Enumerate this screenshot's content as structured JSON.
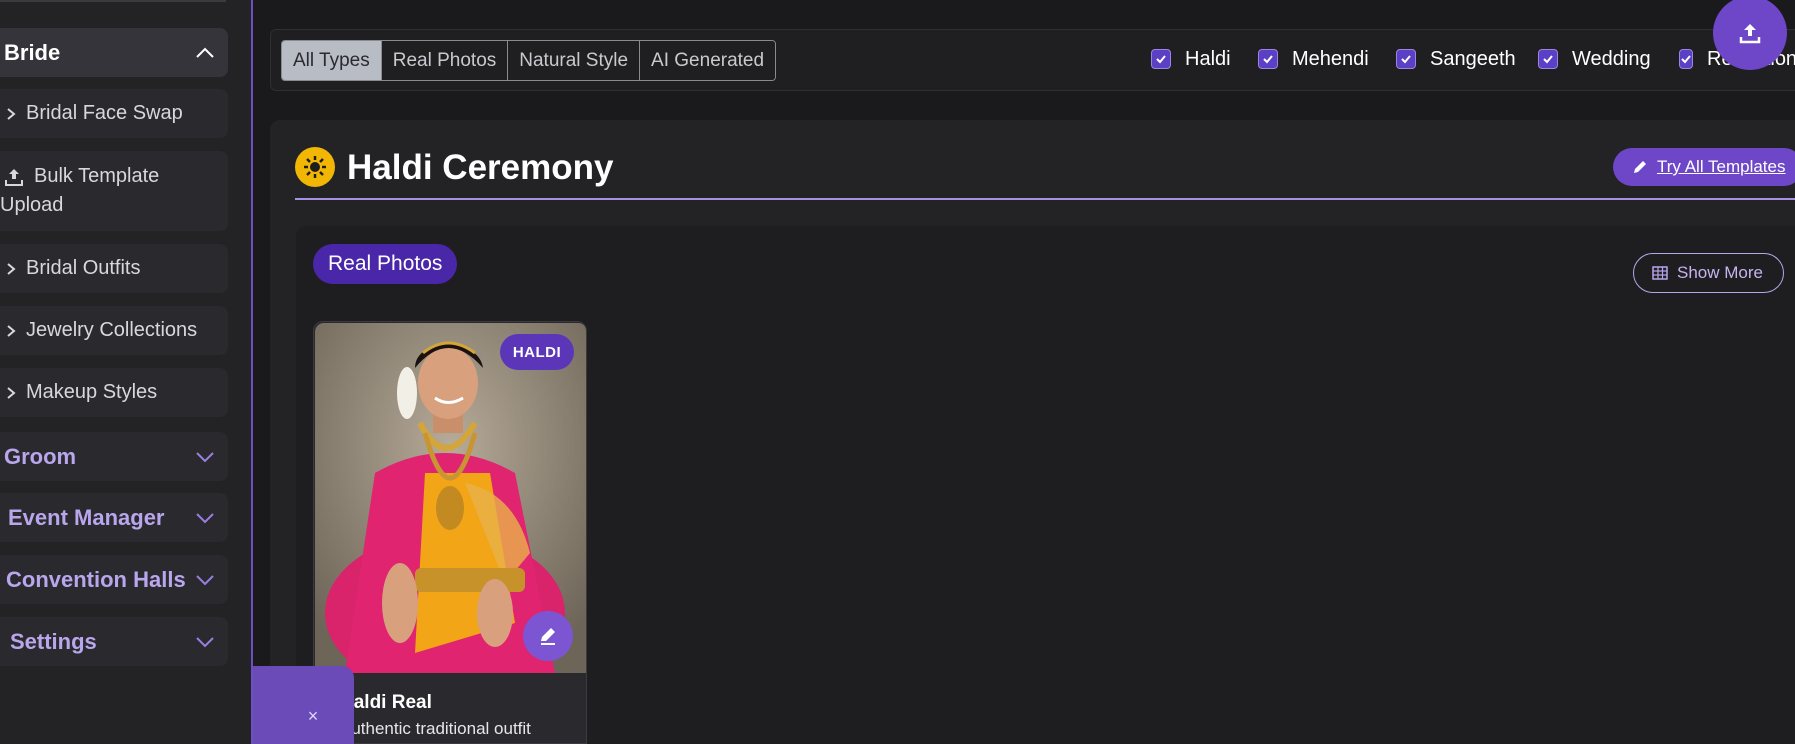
{
  "sidebar": {
    "sections": [
      {
        "label": "Bride",
        "expanded": true
      },
      {
        "label": "Groom",
        "expanded": false
      },
      {
        "label": "Event Manager",
        "expanded": false
      },
      {
        "label": "Convention Halls",
        "expanded": false
      },
      {
        "label": "Settings",
        "expanded": false
      }
    ],
    "bride_items": [
      {
        "label": "Bridal Face Swap",
        "icon": "chevron-right-icon"
      },
      {
        "label": "Bulk Template",
        "label2": "Upload",
        "icon": "upload-icon"
      },
      {
        "label": "Bridal Outfits",
        "icon": "chevron-right-icon"
      },
      {
        "label": "Jewelry Collections",
        "icon": "chevron-right-icon"
      },
      {
        "label": "Makeup Styles",
        "icon": "chevron-right-icon"
      }
    ]
  },
  "filters": {
    "types": [
      "All Types",
      "Real Photos",
      "Natural Style",
      "AI Generated"
    ],
    "active_type": "All Types",
    "events": [
      {
        "label": "Haldi",
        "checked": true
      },
      {
        "label": "Mehendi",
        "checked": true
      },
      {
        "label": "Sangeeth",
        "checked": true
      },
      {
        "label": "Wedding",
        "checked": true
      },
      {
        "label": "Reception",
        "checked": true
      }
    ]
  },
  "section": {
    "title": "Haldi Ceremony",
    "icon": "sun-icon",
    "try_all": "Try All Templates"
  },
  "group": {
    "label": "Real Photos",
    "show_more": "Show More"
  },
  "card": {
    "badge": "HALDI",
    "title": "Haldi Real",
    "description": "Authentic traditional outfit"
  },
  "toast": {
    "close": "×"
  },
  "colors": {
    "accent": "#6e47c9",
    "pill": "#4a27a8",
    "sun": "#f2b705"
  }
}
